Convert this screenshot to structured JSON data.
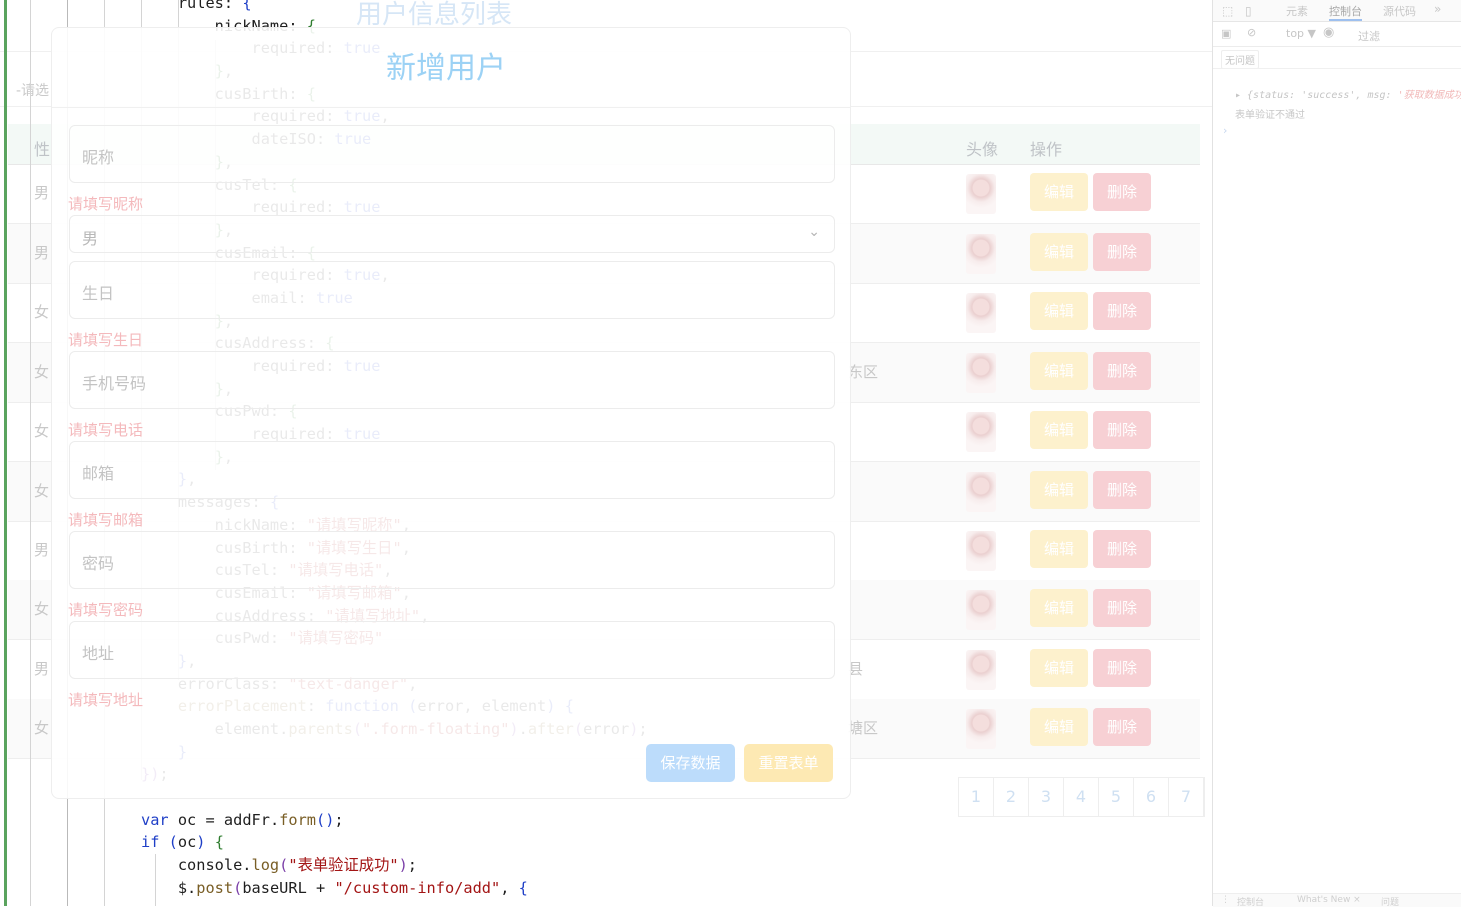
{
  "page": {
    "title": "用户信息列表",
    "filter_placeholder": "-请选",
    "table_headers": {
      "sex": "性",
      "avatar": "头像",
      "actions": "操作"
    },
    "rows": [
      {
        "sex": "男",
        "addr": ""
      },
      {
        "sex": "男",
        "addr": ""
      },
      {
        "sex": "女",
        "addr": ""
      },
      {
        "sex": "女",
        "addr": "东区"
      },
      {
        "sex": "女",
        "addr": ""
      },
      {
        "sex": "女",
        "addr": ""
      },
      {
        "sex": "男",
        "addr": ""
      },
      {
        "sex": "女",
        "addr": ""
      },
      {
        "sex": "男",
        "addr": "县"
      },
      {
        "sex": "女",
        "addr": "塘区"
      }
    ],
    "edit_label": "编辑",
    "delete_label": "删除",
    "pagination": [
      "1",
      "2",
      "3",
      "4",
      "5",
      "6",
      "7"
    ]
  },
  "modal": {
    "title": "新增用户",
    "nickname_placeholder": "昵称",
    "nickname_error": "请填写昵称",
    "sex_value": "男",
    "birth_placeholder": "生日",
    "birth_error": "请填写生日",
    "tel_placeholder": "手机号码",
    "tel_error": "请填写电话",
    "email_placeholder": "邮箱",
    "email_error": "请填写邮箱",
    "pwd_placeholder": "密码",
    "pwd_error": "请填写密码",
    "addr_placeholder": "地址",
    "addr_error": "请填写地址",
    "save_label": "保存数据",
    "reset_label": "重置表单"
  },
  "devtools": {
    "tabs": [
      "元素",
      "控制台",
      "源代码"
    ],
    "active_tab": "控制台",
    "context": "top ▼",
    "filter_placeholder": "过滤",
    "issues_label": "无问题",
    "log_object_prefix": "▸ {status: 'success', msg: ",
    "log_object_msg": "'获取数据成功",
    "log_message": "表单验证不通过",
    "bottom_tabs": [
      "控制台",
      "What's New ×",
      "问题"
    ]
  },
  "icons": {
    "chevron": "chevron-down-icon",
    "inspect": "inspect-icon",
    "device": "device-toolbar-icon",
    "more": "more-tabs-icon",
    "eye": "eye-icon",
    "clear": "clear-icon",
    "sidebar": "sidebar-toggle-icon"
  }
}
